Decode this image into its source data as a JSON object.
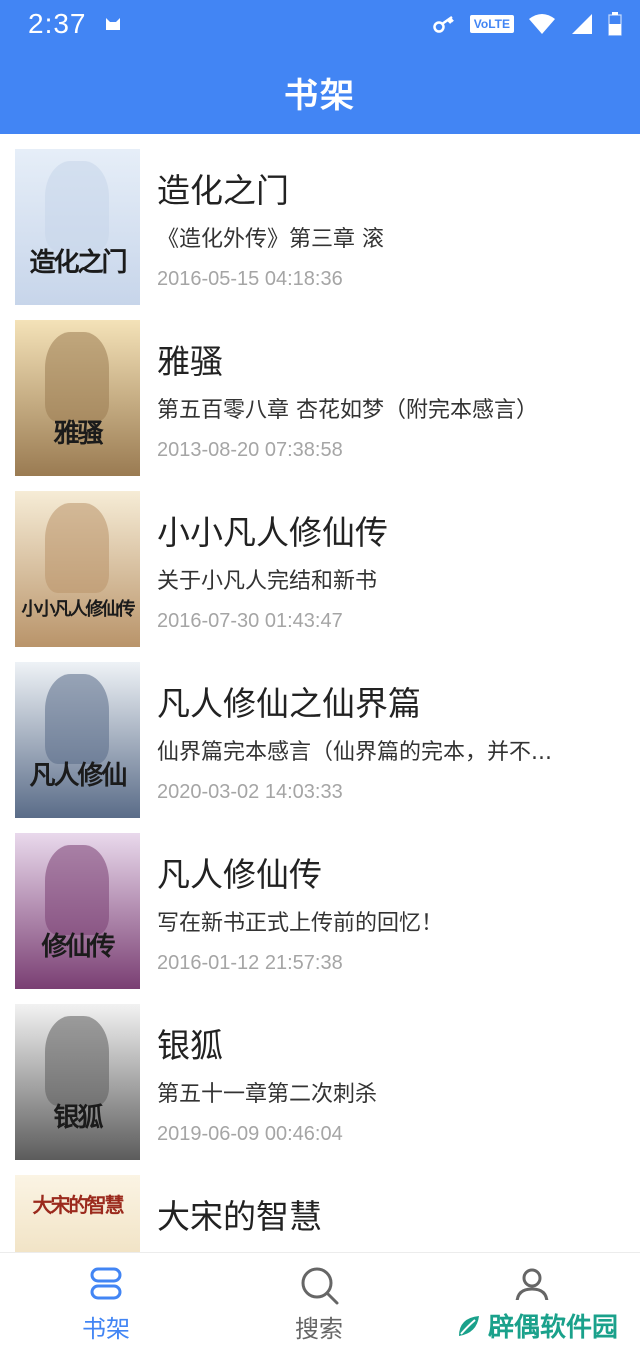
{
  "status_bar": {
    "time": "2:37",
    "volte": "VoLTE"
  },
  "header": {
    "title": "书架"
  },
  "books": [
    {
      "name": "造化之门",
      "chapter": "《造化外传》第三章 滚",
      "date": "2016-05-15 04:18:36",
      "cover_title": "造化之门",
      "cover_colors": [
        "#e6eef8",
        "#c7d5ea"
      ]
    },
    {
      "name": "雅骚",
      "chapter": "第五百零八章 杏花如梦（附完本感言）",
      "date": "2013-08-20 07:38:58",
      "cover_title": "雅骚",
      "cover_colors": [
        "#f4e2b8",
        "#9a7b52"
      ]
    },
    {
      "name": "小小凡人修仙传",
      "chapter": "关于小凡人完结和新书",
      "date": "2016-07-30 01:43:47",
      "cover_title": "小小凡人修仙传",
      "cover_colors": [
        "#f6ecd6",
        "#b9946a"
      ]
    },
    {
      "name": "凡人修仙之仙界篇",
      "chapter": "仙界篇完本感言（仙界篇的完本，并不...",
      "date": "2020-03-02 14:03:33",
      "cover_title": "凡人修仙",
      "cover_colors": [
        "#eef2f6",
        "#5a6c88"
      ]
    },
    {
      "name": "凡人修仙传",
      "chapter": "写在新书正式上传前的回忆！",
      "date": "2016-01-12 21:57:38",
      "cover_title": "修仙传",
      "cover_colors": [
        "#e9d9ec",
        "#7a3f73"
      ]
    },
    {
      "name": "银狐",
      "chapter": "第五十一章第二次刺杀",
      "date": "2019-06-09 00:46:04",
      "cover_title": "银狐",
      "cover_colors": [
        "#f2f2f2",
        "#5c5c5c"
      ]
    },
    {
      "name": "大宋的智慧",
      "chapter": "",
      "date": "",
      "cover_title": "大宋的智慧",
      "cover_colors": [
        "#fbf4e4",
        "#e8d3a8"
      ]
    }
  ],
  "tabs": [
    {
      "label": "书架",
      "icon": "bookshelf-icon",
      "active": true
    },
    {
      "label": "搜索",
      "icon": "search-icon",
      "active": false
    },
    {
      "label": "",
      "icon": "user-icon",
      "active": false
    }
  ],
  "watermark": {
    "text": "辟偶软件园"
  },
  "colors": {
    "accent": "#4285f4",
    "tab_inactive": "#666666",
    "watermark": "#1aa18b"
  }
}
